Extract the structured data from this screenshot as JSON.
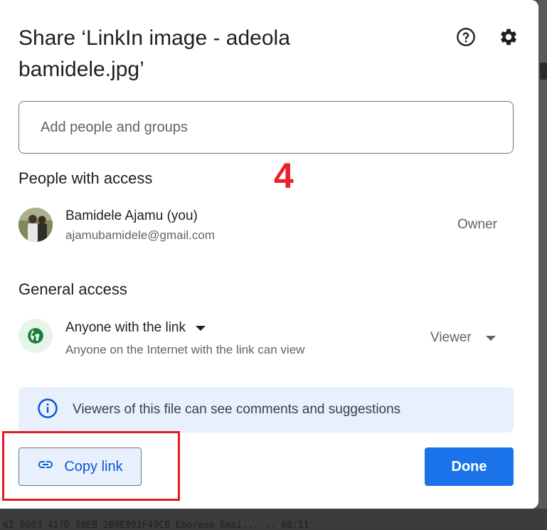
{
  "dialog": {
    "title": "Share ‘LinkIn image - adeola bamidele.jpg’",
    "help_icon": "help-circle-icon",
    "settings_icon": "gear-icon"
  },
  "add_people": {
    "placeholder": "Add people and groups"
  },
  "annotation": {
    "step_number": "4",
    "color": "#e8202a"
  },
  "people_with_access": {
    "title": "People with access",
    "people": [
      {
        "name": "Bamidele Ajamu (you)",
        "email": "ajamubamidele@gmail.com",
        "role": "Owner"
      }
    ]
  },
  "general_access": {
    "title": "General access",
    "access_level": "Anyone with the link",
    "description": "Anyone on the Internet with the link can view",
    "role": "Viewer",
    "icon": "globe-icon"
  },
  "info_banner": {
    "icon": "info-icon",
    "text": "Viewers of this file can see comments and suggestions"
  },
  "actions": {
    "copy_link": "Copy link",
    "copy_link_icon": "link-icon",
    "done": "Done",
    "highlight_color": "#e21b23"
  },
  "background": {
    "text": "62 8003 417D 88EB 2B9E891F49CB   Eboreem Emsi...   ..  08:11"
  },
  "colors": {
    "primary": "#1a73e8",
    "link_blue": "#0b57d0",
    "banner_bg": "#e8f0fe",
    "globe_green": "#188038"
  }
}
